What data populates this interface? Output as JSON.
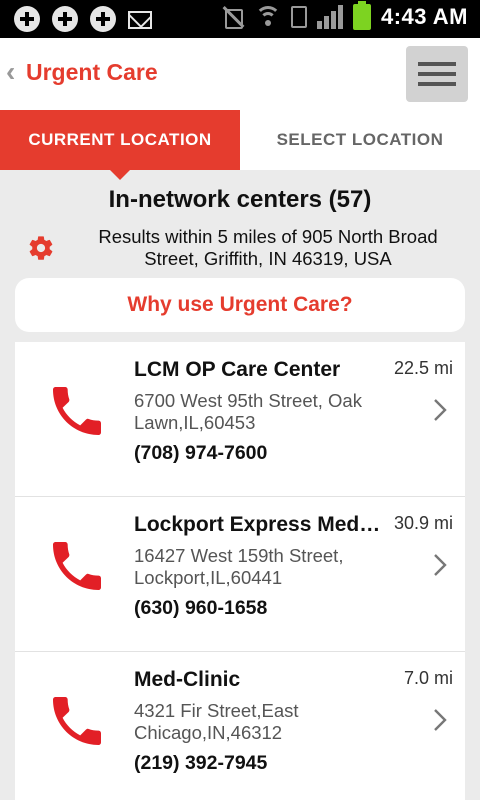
{
  "status_bar": {
    "time": "4:43 AM",
    "icons": [
      "plus-icon",
      "plus-icon",
      "plus-icon",
      "mail-icon",
      "mute-icon",
      "wifi-icon",
      "sim-icon",
      "signal-icon",
      "battery-icon"
    ]
  },
  "header": {
    "back_icon": "chevron-left-icon",
    "title": "Urgent Care",
    "menu_icon": "hamburger-menu-icon"
  },
  "tabs": [
    {
      "label": "CURRENT LOCATION",
      "active": true
    },
    {
      "label": "SELECT LOCATION",
      "active": false
    }
  ],
  "summary": {
    "heading": "In-network centers (57)",
    "results_text": "Results within 5 miles of 905 North Broad Street, Griffith, IN 46319, USA",
    "settings_icon": "gear-icon"
  },
  "why_button": {
    "label": "Why use Urgent Care?"
  },
  "centers": [
    {
      "name": "LCM OP Care Center",
      "distance": "22.5 mi",
      "address": "6700 West 95th Street, Oak Lawn,IL,60453",
      "phone": "(708) 974-7600"
    },
    {
      "name": "Lockport Express Med…",
      "distance": "30.9 mi",
      "address": "16427 West 159th Street, Lockport,IL,60441",
      "phone": "(630) 960-1658"
    },
    {
      "name": "Med-Clinic",
      "distance": "7.0 mi",
      "address": "4321 Fir Street,East Chicago,IN,46312",
      "phone": "(219) 392-7945"
    }
  ],
  "colors": {
    "accent": "#e53c2e",
    "background": "#ebebeb",
    "card": "#ffffff"
  }
}
